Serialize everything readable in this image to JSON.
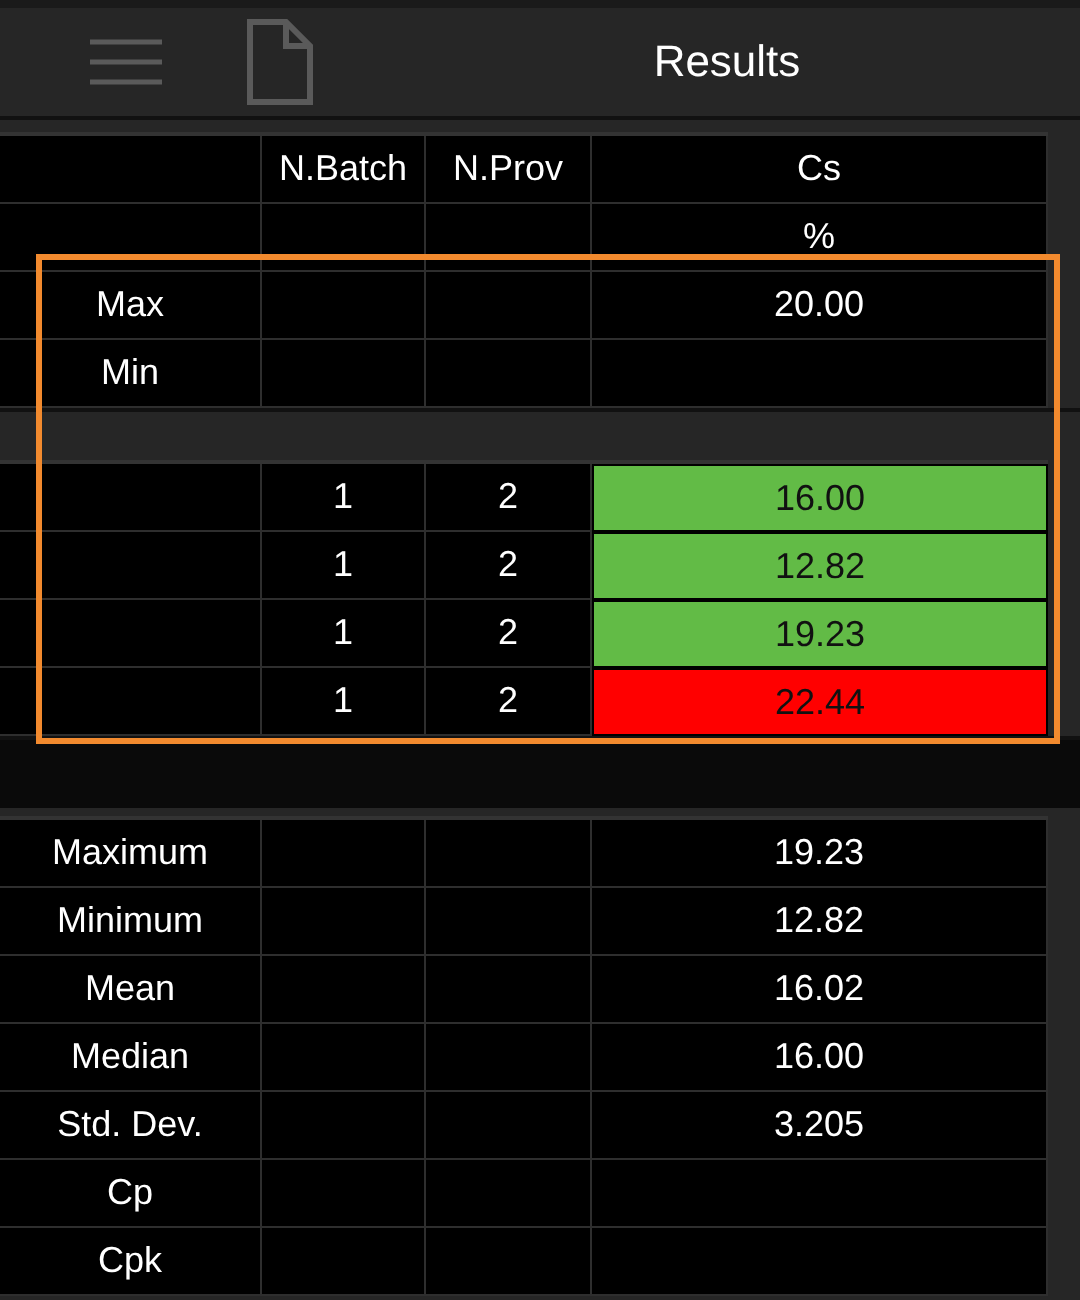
{
  "header": {
    "title": "Results"
  },
  "columns": [
    "N.Batch",
    "N.Prov",
    "Cs"
  ],
  "units": {
    "cs": "%"
  },
  "limits": [
    {
      "label": "Max",
      "cs": "20.00"
    },
    {
      "label": "Min"
    }
  ],
  "measurements": [
    {
      "batch": "1",
      "prov": "2",
      "value": "16.00",
      "color": "#62bb46"
    },
    {
      "batch": "1",
      "prov": "2",
      "value": "12.82",
      "color": "#62bb46"
    },
    {
      "batch": "1",
      "prov": "2",
      "value": "19.23",
      "color": "#62bb46"
    },
    {
      "batch": "1",
      "prov": "2",
      "value": "22.44",
      "color": "#ff0000"
    }
  ],
  "statistics": [
    {
      "label": "Maximum",
      "value": "19.23"
    },
    {
      "label": "Minimum",
      "value": "12.82"
    },
    {
      "label": "Mean",
      "value": "16.02"
    },
    {
      "label": "Median",
      "value": "16.00"
    },
    {
      "label": "Std. Dev.",
      "value": "3.205"
    },
    {
      "label": "Cp"
    },
    {
      "label": "Cpk"
    }
  ]
}
